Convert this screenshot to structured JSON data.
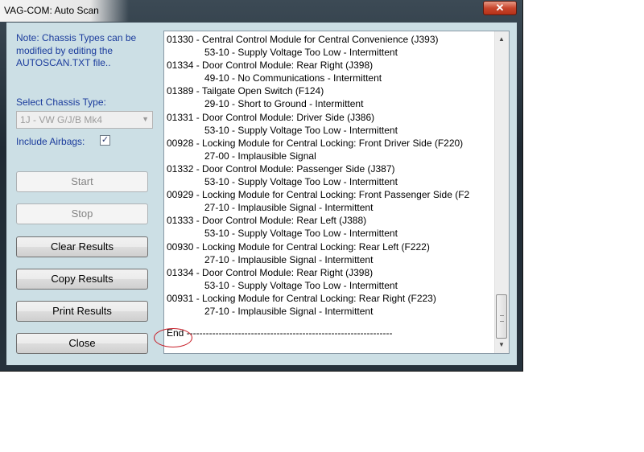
{
  "window": {
    "title": "VAG-COM: Auto Scan",
    "close_glyph": "✕"
  },
  "sidebar": {
    "note": "Note:  Chassis Types can be modified by editing the AUTOSCAN.TXT file..",
    "chassis_label": "Select Chassis Type:",
    "chassis_value": "1J - VW G/J/B Mk4",
    "airbags_label": "Include Airbags:",
    "airbags_checked": true,
    "buttons": {
      "start": "Start",
      "stop": "Stop",
      "clear": "Clear Results",
      "copy": "Copy Results",
      "print": "Print Results",
      "close": "Close"
    }
  },
  "results": {
    "lines": [
      "01330 - Central Control Module for Central Convenience (J393)",
      "53-10 - Supply Voltage Too Low - Intermittent",
      "01334 - Door Control Module: Rear Right (J398)",
      "49-10 - No Communications - Intermittent",
      "01389 - Tailgate Open Switch (F124)",
      "29-10 - Short to Ground - Intermittent",
      "01331 - Door Control Module: Driver Side (J386)",
      "53-10 - Supply Voltage Too Low - Intermittent",
      "00928 - Locking Module for Central Locking: Front Driver Side (F220)",
      "27-00 - Implausible Signal",
      "01332 - Door Control Module: Passenger Side (J387)",
      "53-10 - Supply Voltage Too Low - Intermittent",
      "00929 - Locking Module for Central Locking: Front Passenger Side (F2",
      "27-10 - Implausible Signal - Intermittent",
      "01333 - Door Control Module: Rear Left (J388)",
      "53-10 - Supply Voltage Too Low - Intermittent",
      "00930 - Locking Module for Central Locking: Rear Left (F222)",
      "27-10 - Implausible Signal - Intermittent",
      "01334 - Door Control Module: Rear Right (J398)",
      "53-10 - Supply Voltage Too Low - Intermittent",
      "00931 - Locking Module for Central Locking: Rear Right (F223)",
      "27-10 - Implausible Signal - Intermittent"
    ],
    "end_text": "End ----------------------------------------------------------------"
  }
}
